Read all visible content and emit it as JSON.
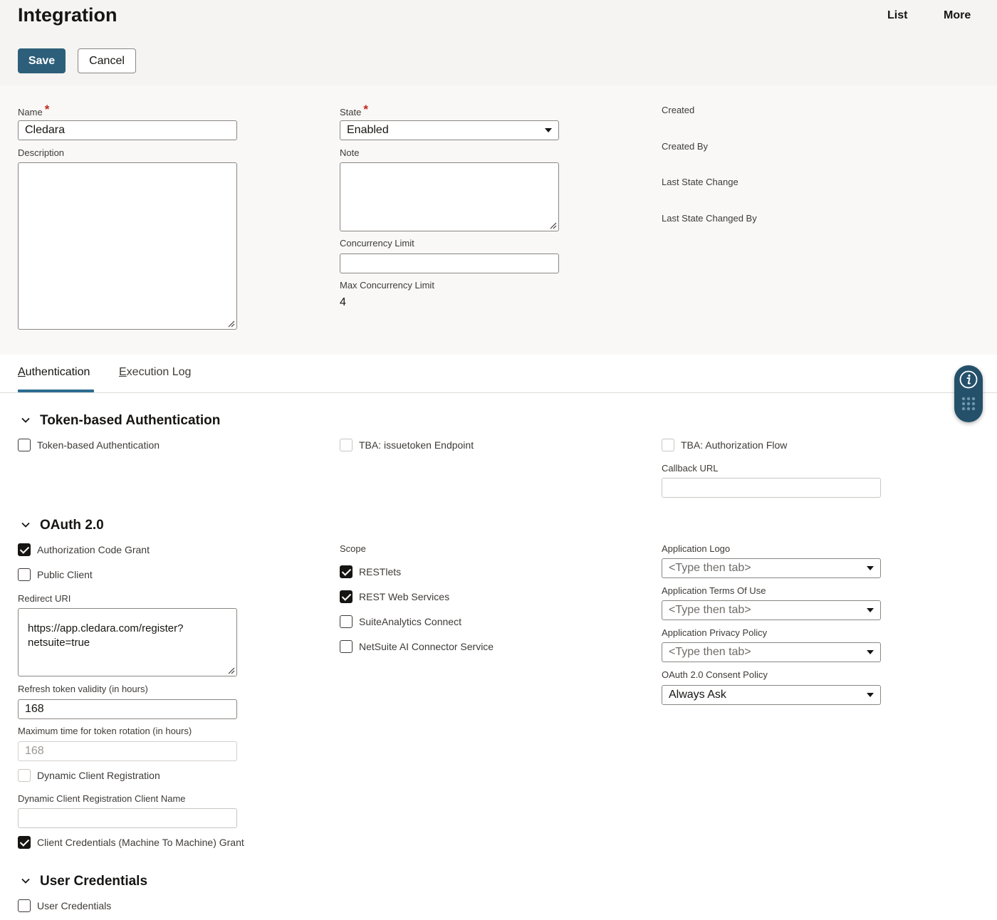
{
  "header": {
    "title": "Integration",
    "links": {
      "list": "List",
      "more": "More"
    },
    "save_label": "Save",
    "cancel_label": "Cancel"
  },
  "form": {
    "name": {
      "label": "Name",
      "value": "Cledara"
    },
    "description": {
      "label": "Description",
      "value": ""
    },
    "state": {
      "label": "State",
      "value": "Enabled"
    },
    "note": {
      "label": "Note",
      "value": ""
    },
    "concurrency_limit": {
      "label": "Concurrency Limit",
      "value": ""
    },
    "max_concurrency_limit": {
      "label": "Max Concurrency Limit",
      "value": "4"
    },
    "meta": {
      "created": "Created",
      "created_by": "Created By",
      "last_state_change": "Last State Change",
      "last_state_changed_by": "Last State Changed By"
    }
  },
  "tabs": {
    "authentication": {
      "first": "A",
      "rest": "uthentication"
    },
    "execution_log": {
      "first": "E",
      "rest": "xecution Log"
    }
  },
  "tba": {
    "title": "Token-based Authentication",
    "token_based_auth": {
      "label": "Token-based Authentication",
      "checked": false
    },
    "issuetoken_endpoint": {
      "label": "TBA: issuetoken Endpoint",
      "checked": false
    },
    "authorization_flow": {
      "label": "TBA: Authorization Flow",
      "checked": false
    },
    "callback_url": {
      "label": "Callback URL",
      "value": ""
    }
  },
  "oauth": {
    "title": "OAuth 2.0",
    "authorization_code_grant": {
      "label": "Authorization Code Grant",
      "checked": true
    },
    "public_client": {
      "label": "Public Client",
      "checked": false
    },
    "redirect_uri": {
      "label": "Redirect URI",
      "line1": "https://app.cledara.com/register?",
      "line2": "netsuite=true"
    },
    "refresh_token_validity": {
      "label": "Refresh token validity (in hours)",
      "value": "168"
    },
    "max_token_rotation": {
      "label": "Maximum time for token rotation (in hours)",
      "value": "168"
    },
    "dynamic_client_registration": {
      "label": "Dynamic Client Registration",
      "checked": false
    },
    "dcr_client_name": {
      "label": "Dynamic Client Registration Client Name",
      "value": ""
    },
    "client_credentials_grant": {
      "label": "Client Credentials (Machine To Machine) Grant",
      "checked": true
    },
    "scope": {
      "label": "Scope",
      "restlets": {
        "label": "RESTlets",
        "checked": true
      },
      "rest_web_services": {
        "label": "REST Web Services",
        "checked": true
      },
      "suiteanalytics_connect": {
        "label": "SuiteAnalytics Connect",
        "checked": false
      },
      "ai_connector": {
        "label": "NetSuite AI Connector Service",
        "checked": false
      }
    },
    "application_logo": {
      "label": "Application Logo",
      "placeholder": "<Type then tab>"
    },
    "terms_of_use": {
      "label": "Application Terms Of Use",
      "placeholder": "<Type then tab>"
    },
    "privacy_policy": {
      "label": "Application Privacy Policy",
      "placeholder": "<Type then tab>"
    },
    "consent_policy": {
      "label": "OAuth 2.0 Consent Policy",
      "value": "Always Ask"
    }
  },
  "user_credentials": {
    "title": "User Credentials",
    "user_credentials": {
      "label": "User Credentials",
      "checked": false
    }
  },
  "colors": {
    "primary_button": "#2d5f7a",
    "tab_active": "#2d6c90",
    "required": "#c0281c",
    "widget": "#24506a"
  }
}
